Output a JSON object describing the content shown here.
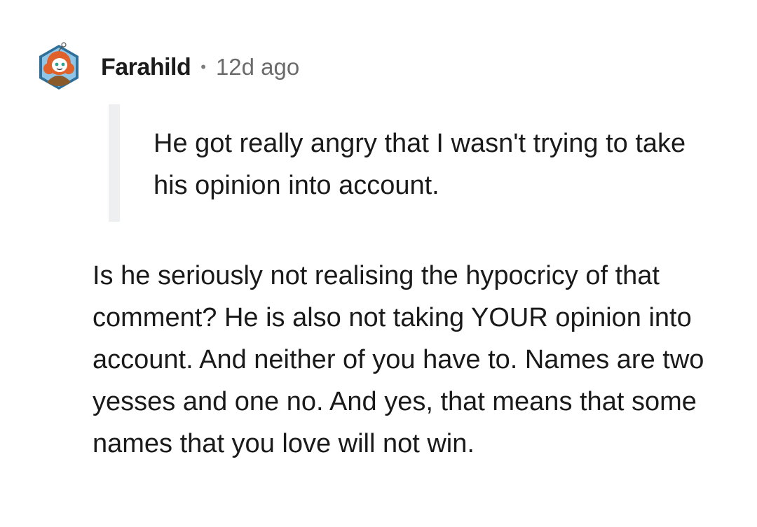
{
  "comment": {
    "author": "Farahild",
    "separator": "•",
    "timestamp": "12d ago",
    "avatar_icon": "reddit-snoo-avatar-icon",
    "quote": "He got really angry that I wasn't trying to take his opinion into account.",
    "body": "Is he seriously not realising the hypocricy of that comment? He is also not taking YOUR opinion into account. And neither of you have to. Names are two yesses and one no. And yes, that means that some names that you love will not win."
  },
  "colors": {
    "background": "#ffffff",
    "text": "#1a1a1b",
    "meta": "#6b6b6b",
    "quote_bar": "#edeff1",
    "avatar_hex": "#2f6f9a",
    "avatar_hair": "#e0622a"
  }
}
